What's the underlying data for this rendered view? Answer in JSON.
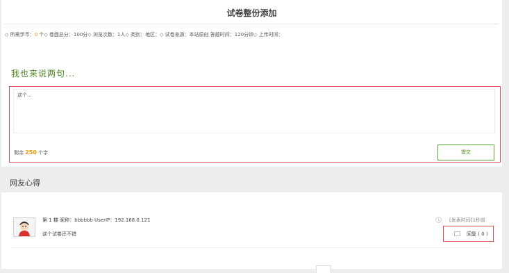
{
  "page": {
    "title": "试卷整份添加"
  },
  "meta": {
    "prefix": "◇ 所需学币：",
    "coins": "0",
    "rest": " 个◇ 卷面总分：100分◇ 浏览次数：1人◇ 类别：地区：◇ 试卷来源：本站原创 答题时间：120分钟◇ 上传时间："
  },
  "comment_form": {
    "heading": "我也来说两句...",
    "textarea_value": "这个...",
    "remaining_prefix": "剩余 ",
    "remaining_count": "250",
    "remaining_suffix": " 个字",
    "submit_label": "提交"
  },
  "comments_section": {
    "title": "网友心得",
    "items": [
      {
        "header": "第 1 楼 昵称：bbbbbb UserIP：192.168.0.121",
        "body": "这个试卷还不错",
        "time": "[发表时间]1秒前",
        "reply_label": "回复 ( 0 )"
      }
    ]
  },
  "colors": {
    "accent_green": "#4a8c1c",
    "highlight_orange": "#f39800",
    "outline_red": "#d9534f"
  },
  "icons": [
    "clock-icon",
    "reply-icon",
    "user-avatar"
  ]
}
